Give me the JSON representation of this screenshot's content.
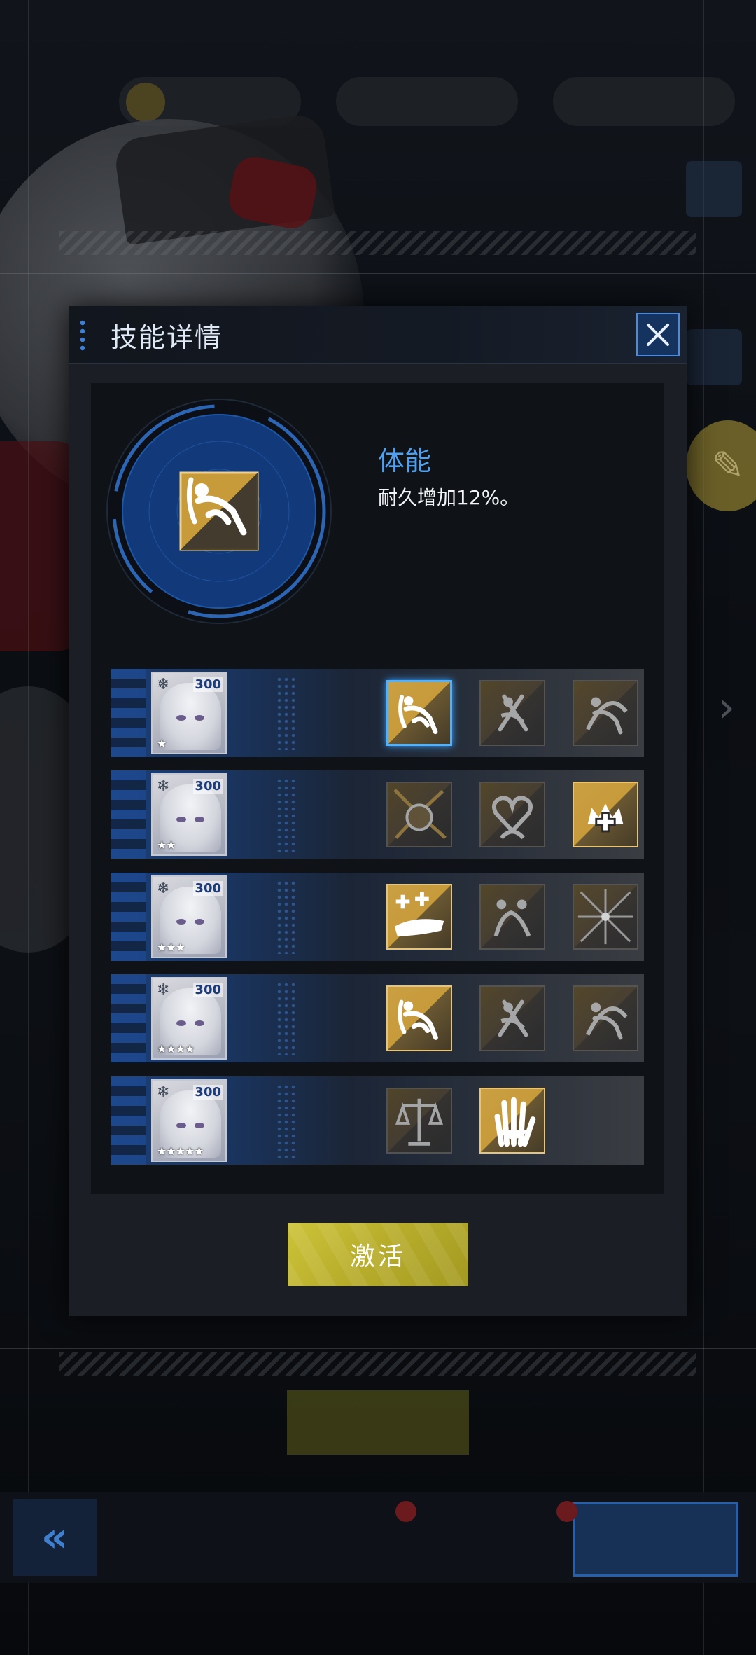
{
  "modal": {
    "title": "技能详情",
    "skill_name": "体能",
    "skill_desc": "耐久增加12%。",
    "activate_label": "激活"
  },
  "rows": [
    {
      "level": "300",
      "stars": "★",
      "icons": [
        {
          "name": "stamina-icon",
          "state": "selected"
        },
        {
          "name": "stamina-swords-icon",
          "state": "locked"
        },
        {
          "name": "stamina-bow-icon",
          "state": "locked"
        }
      ]
    },
    {
      "level": "300",
      "stars": "★★",
      "icons": [
        {
          "name": "fist-burst-icon",
          "state": "locked"
        },
        {
          "name": "heart-hands-icon",
          "state": "locked"
        },
        {
          "name": "crown-heal-icon",
          "state": "active"
        }
      ]
    },
    {
      "level": "300",
      "stars": "★★★",
      "icons": [
        {
          "name": "hand-heal-icon",
          "state": "active"
        },
        {
          "name": "double-fighter-icon",
          "state": "locked"
        },
        {
          "name": "starburst-icon",
          "state": "locked"
        }
      ]
    },
    {
      "level": "300",
      "stars": "★★★★",
      "icons": [
        {
          "name": "stamina-icon",
          "state": "active"
        },
        {
          "name": "stamina-swords-icon",
          "state": "locked"
        },
        {
          "name": "stamina-bow-icon",
          "state": "locked"
        }
      ]
    },
    {
      "level": "300",
      "stars": "★★★★★",
      "icons": [
        {
          "name": "balance-scale-icon",
          "state": "locked"
        },
        {
          "name": "raised-hand-icon",
          "state": "active"
        }
      ]
    }
  ],
  "colors": {
    "accent_blue": "#4fa0f0",
    "activate_yellow": "#cdc339",
    "skill_gold": "#caa043"
  }
}
